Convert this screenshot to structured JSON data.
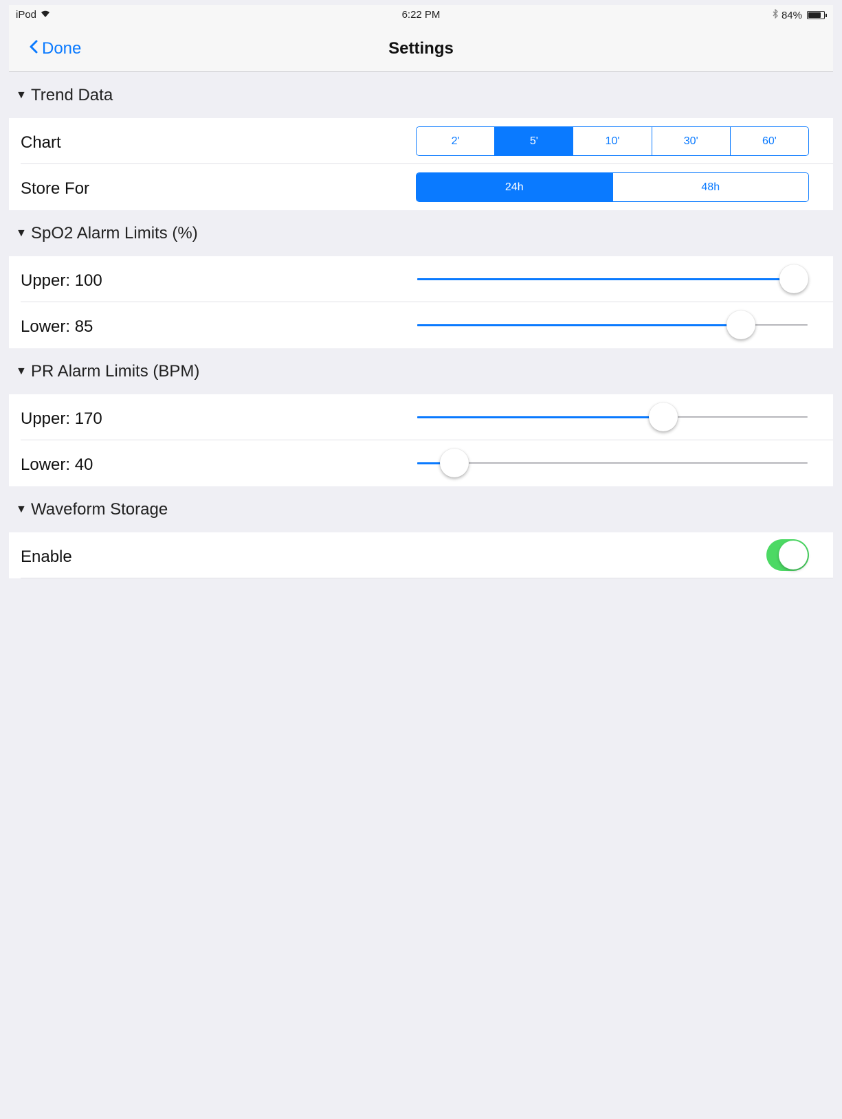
{
  "status_bar": {
    "device": "iPod",
    "wifi_icon": "wifi-icon",
    "time": "6:22 PM",
    "bluetooth_icon": "bluetooth-icon",
    "battery_percent": "84%",
    "battery_level": 0.84
  },
  "nav": {
    "back_label": "Done",
    "back_icon": "chevron-left-icon",
    "title": "Settings"
  },
  "sections": {
    "trend": {
      "header": "Trend Data",
      "chart": {
        "label": "Chart",
        "options": [
          "2'",
          "5'",
          "10'",
          "30'",
          "60'"
        ],
        "selected": 1
      },
      "store": {
        "label": "Store For",
        "options": [
          "24h",
          "48h"
        ],
        "selected": 0
      }
    },
    "spo2": {
      "header": "SpO2 Alarm Limits (%)",
      "upper": {
        "label": "Upper: 100",
        "level": 0.965
      },
      "lower": {
        "label": "Lower: 85",
        "level": 0.83
      }
    },
    "pr": {
      "header": "PR Alarm Limits (BPM)",
      "upper": {
        "label": "Upper: 170",
        "level": 0.63
      },
      "lower": {
        "label": "Lower: 40",
        "level": 0.095
      }
    },
    "waveform": {
      "header": "Waveform Storage",
      "enable": {
        "label": "Enable",
        "on": true
      }
    }
  },
  "colors": {
    "accent": "#0a7aff",
    "toggle_on": "#4cd964",
    "background": "#efeff4"
  }
}
